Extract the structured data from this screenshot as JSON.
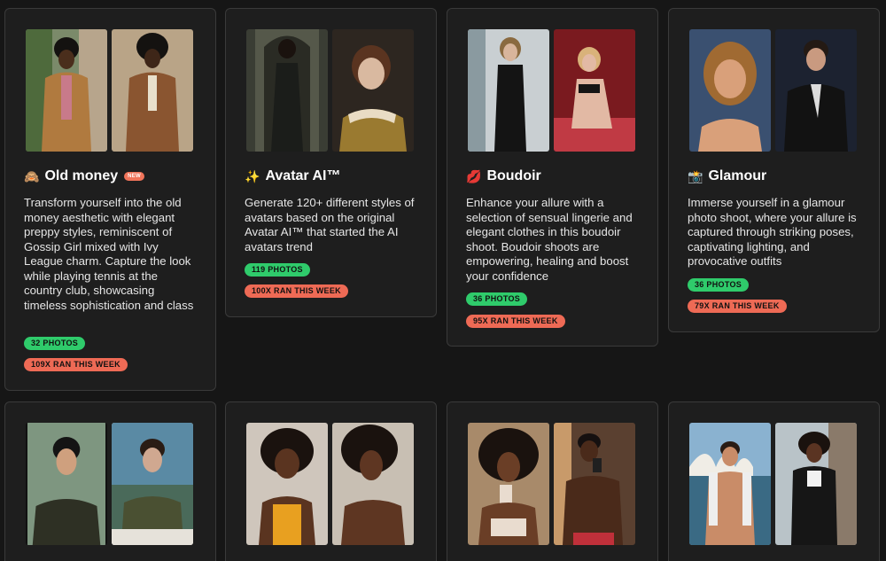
{
  "presets": [
    {
      "emoji": "🙈",
      "title": "Old money",
      "badge": "NEW",
      "description": "Transform yourself into the old money aesthetic with elegant preppy styles, reminiscent of Gossip Girl mixed with Ivy League charm. Capture the look while playing tennis at the country club, showcasing timeless sophistication and class",
      "photos": "32 PHOTOS",
      "ran": "109X RAN THIS WEEK"
    },
    {
      "emoji": "✨",
      "title": "Avatar AI™",
      "description": "Generate 120+ different styles of avatars based on the original Avatar AI™ that started the AI avatars trend",
      "photos": "119 PHOTOS",
      "ran": "100X RAN THIS WEEK"
    },
    {
      "emoji": "💋",
      "title": "Boudoir",
      "description": "Enhance your allure with a selection of sensual lingerie and elegant clothes in this boudoir shoot. Boudoir shoots are empowering, healing and boost your confidence",
      "photos": "36 PHOTOS",
      "ran": "95X RAN THIS WEEK"
    },
    {
      "emoji": "📸",
      "title": "Glamour",
      "description": "Immerse yourself in a glamour photo shoot, where your allure is captured through striking poses, captivating lighting, and provocative outfits",
      "photos": "36 PHOTOS",
      "ran": "79X RAN THIS WEEK"
    }
  ],
  "colors": {
    "background": "#161616",
    "card": "#1e1e1e",
    "card_border": "#3a3a3a",
    "photos_pill": "#2fcb6b",
    "ran_pill": "#ee6a55",
    "new_badge": "#f0745a"
  }
}
